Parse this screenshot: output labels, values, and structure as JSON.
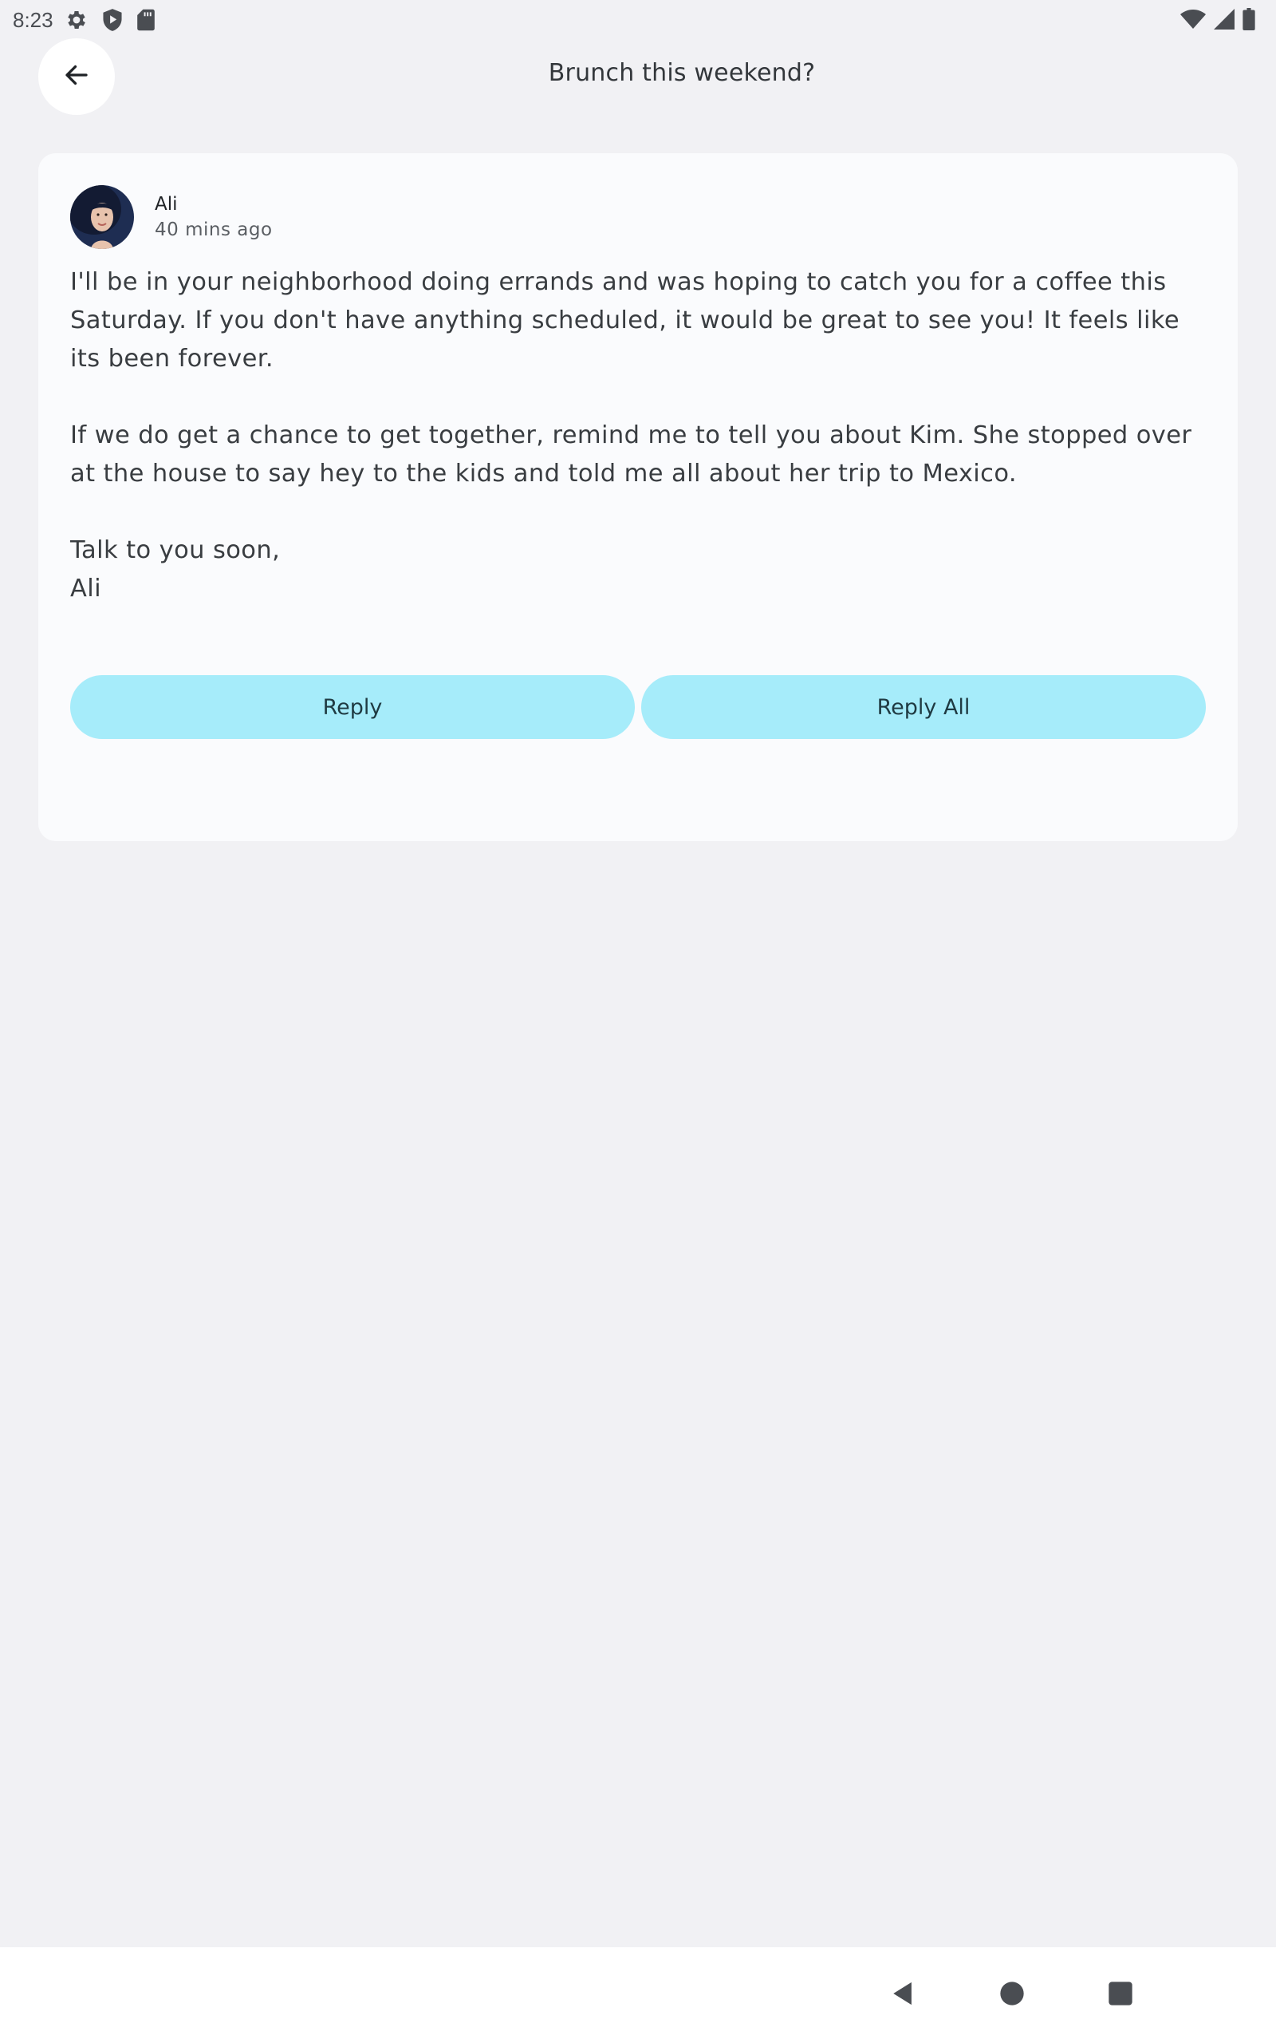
{
  "status_bar": {
    "time": "8:23",
    "icons_left": [
      "gear-icon",
      "shield-play-icon",
      "sd-card-icon"
    ],
    "icons_right": [
      "wifi-icon",
      "signal-icon",
      "battery-icon"
    ]
  },
  "app_bar": {
    "title": "Brunch this weekend?",
    "back_icon": "arrow-back-icon"
  },
  "email": {
    "sender": "Ali",
    "time": "40 mins ago",
    "paragraphs": [
      "I'll be in your neighborhood doing errands and was hoping to catch you for a coffee this Saturday. If you don't have anything scheduled, it would be great to see you! It feels like its been forever.",
      "If we do get a chance to get together, remind me to tell you about Kim. She stopped over at the house to say hey to the kids and told me all about her trip to Mexico."
    ],
    "closing_line1": "Talk to you soon,",
    "closing_line2": "Ali"
  },
  "actions": {
    "reply_label": "Reply",
    "reply_all_label": "Reply All"
  },
  "nav_bar": {
    "icons": [
      "back-triangle-icon",
      "home-circle-icon",
      "recents-square-icon"
    ]
  },
  "colors": {
    "background": "#f1f1f4",
    "card": "#fafbfd",
    "button": "#a6ecfa",
    "text": "#393d41"
  }
}
